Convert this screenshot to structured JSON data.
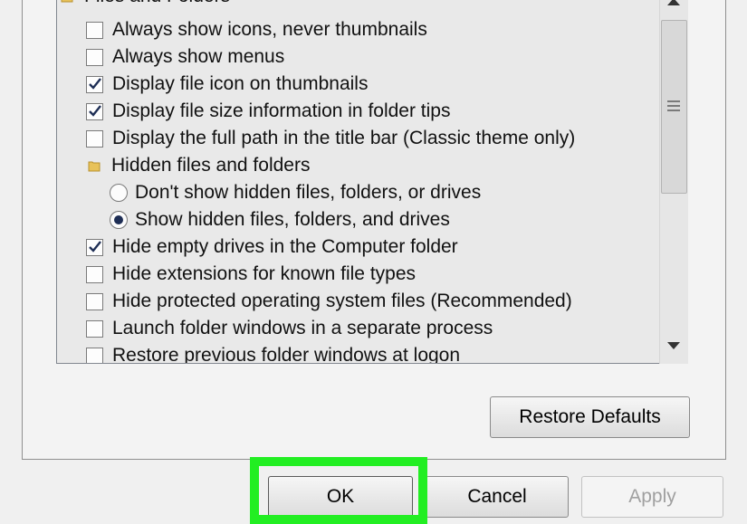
{
  "options": {
    "group_title": "Files and Folders",
    "items": [
      {
        "label": "Always show icons, never thumbnails",
        "type": "checkbox",
        "checked": false
      },
      {
        "label": "Always show menus",
        "type": "checkbox",
        "checked": false
      },
      {
        "label": "Display file icon on thumbnails",
        "type": "checkbox",
        "checked": true
      },
      {
        "label": "Display file size information in folder tips",
        "type": "checkbox",
        "checked": true
      },
      {
        "label": "Display the full path in the title bar (Classic theme only)",
        "type": "checkbox",
        "checked": false
      },
      {
        "label": "Hidden files and folders",
        "type": "folder"
      },
      {
        "label": "Don't show hidden files, folders, or drives",
        "type": "radio",
        "checked": false
      },
      {
        "label": "Show hidden files, folders, and drives",
        "type": "radio",
        "checked": true
      },
      {
        "label": "Hide empty drives in the Computer folder",
        "type": "checkbox",
        "checked": true
      },
      {
        "label": "Hide extensions for known file types",
        "type": "checkbox",
        "checked": false
      },
      {
        "label": "Hide protected operating system files (Recommended)",
        "type": "checkbox",
        "checked": false
      },
      {
        "label": "Launch folder windows in a separate process",
        "type": "checkbox",
        "checked": false
      },
      {
        "label": "Restore previous folder windows at logon",
        "type": "checkbox",
        "checked": false
      }
    ]
  },
  "buttons": {
    "restore_defaults": "Restore Defaults",
    "ok": "OK",
    "cancel": "Cancel",
    "apply": "Apply"
  },
  "colors": {
    "highlight": "#22ee22",
    "check_mark": "#1e2e55"
  }
}
